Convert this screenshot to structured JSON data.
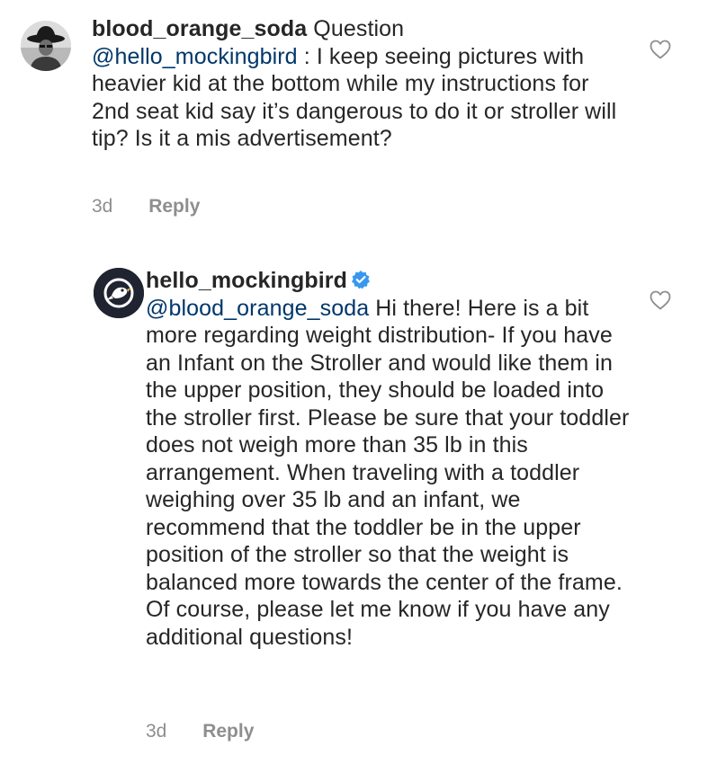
{
  "comments": [
    {
      "username": "blood_orange_soda",
      "tag": "Question",
      "mention": "@hello_mockingbird",
      "text": " : I keep seeing pictures with heavier kid at the bottom while my instructions for 2nd seat kid say it’s dangerous to do it or stroller will tip? Is it a mis advertisement?",
      "time": "3d",
      "reply_label": "Reply",
      "avatar_icon": "cowboy-hat-person-avatar",
      "like_icon": "heart-outline-icon"
    },
    {
      "username": "hello_mockingbird",
      "verified": true,
      "verified_icon": "verified-badge-icon",
      "mention": "@blood_orange_soda",
      "text": " Hi there! Here is a bit more regarding weight distribution- If you have an Infant on the Stroller and would like them in the upper position, they should be loaded into the stroller first. Please be sure that your toddler does not weigh more than 35 lb in this arrangement. When traveling with a toddler weighing over 35 lb and an infant, we recommend that the toddler be in the upper position of the stroller so that the weight is balanced more towards the center of the frame. Of course, please let me know if you have any additional questions!",
      "time": "3d",
      "reply_label": "Reply",
      "avatar_icon": "mockingbird-logo-avatar",
      "like_icon": "heart-outline-icon"
    }
  ],
  "colors": {
    "text": "#262626",
    "mention": "#00376b",
    "meta": "#8e8e8e",
    "verified": "#3897f0"
  }
}
